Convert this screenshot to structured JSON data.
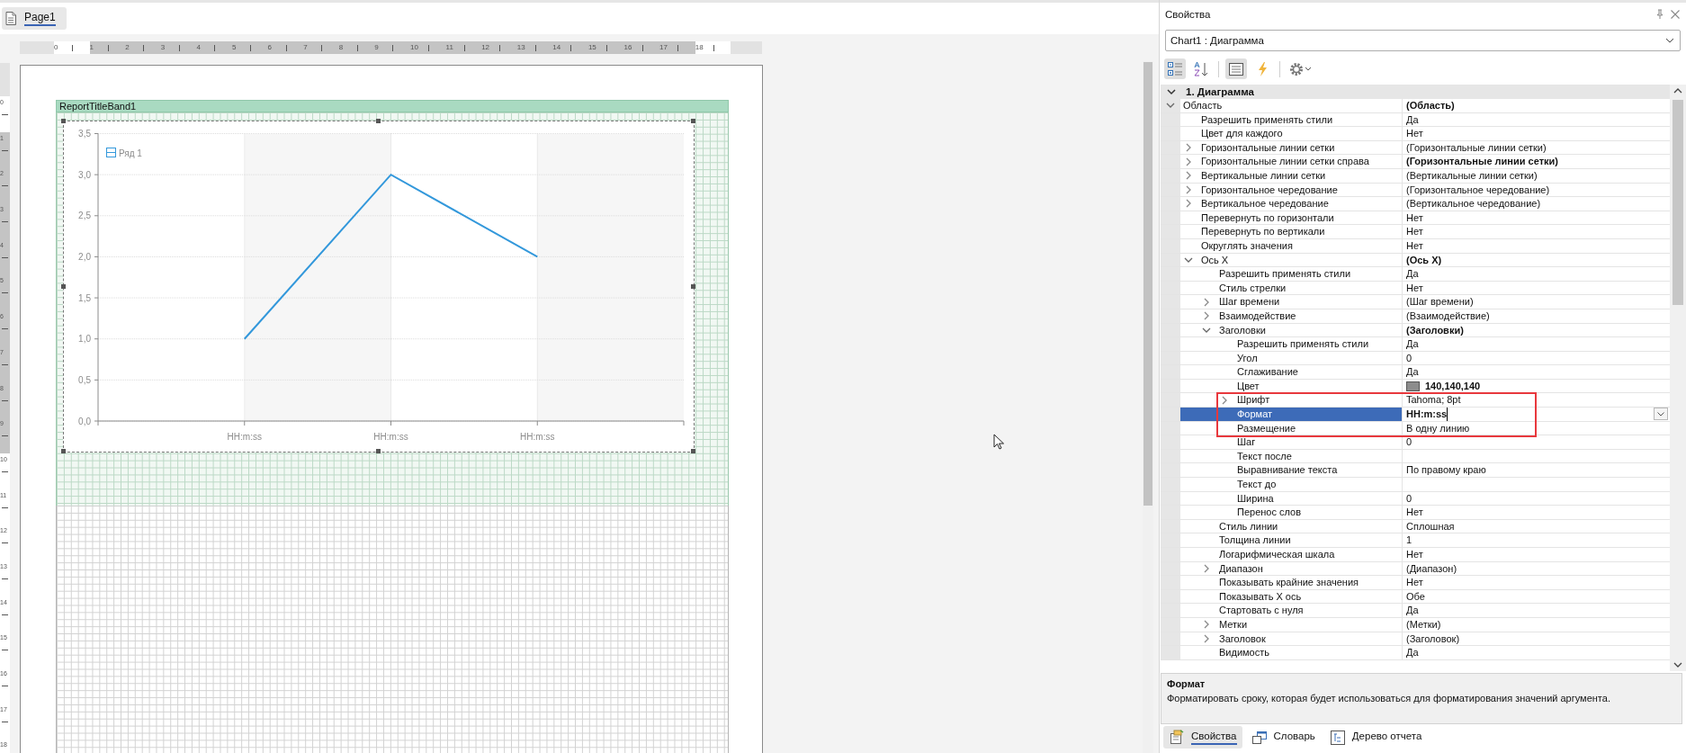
{
  "document_tabs": [
    {
      "label": "Page1",
      "selected": true
    }
  ],
  "rulers": {
    "horizontal": [
      {
        "label": "0",
        "shaded": false
      },
      {
        "label": "1",
        "shaded": true
      },
      {
        "label": "2",
        "shaded": true
      },
      {
        "label": "3",
        "shaded": true
      },
      {
        "label": "4",
        "shaded": true
      },
      {
        "label": "5",
        "shaded": true
      },
      {
        "label": "6",
        "shaded": true
      },
      {
        "label": "7",
        "shaded": true
      },
      {
        "label": "8",
        "shaded": true
      },
      {
        "label": "9",
        "shaded": true
      },
      {
        "label": "10",
        "shaded": true
      },
      {
        "label": "11",
        "shaded": true
      },
      {
        "label": "12",
        "shaded": true
      },
      {
        "label": "13",
        "shaded": true
      },
      {
        "label": "14",
        "shaded": true
      },
      {
        "label": "15",
        "shaded": true
      },
      {
        "label": "16",
        "shaded": true
      },
      {
        "label": "17",
        "shaded": true
      },
      {
        "label": "18",
        "shaded": false
      }
    ],
    "vertical": [
      {
        "label": "0",
        "shaded": false
      },
      {
        "label": "1",
        "shaded": true
      },
      {
        "label": "2",
        "shaded": true
      },
      {
        "label": "3",
        "shaded": true
      },
      {
        "label": "4",
        "shaded": true
      },
      {
        "label": "5",
        "shaded": true
      },
      {
        "label": "6",
        "shaded": true
      },
      {
        "label": "7",
        "shaded": true
      },
      {
        "label": "8",
        "shaded": true
      },
      {
        "label": "9",
        "shaded": true
      },
      {
        "label": "10",
        "shaded": false
      },
      {
        "label": "11",
        "shaded": false
      },
      {
        "label": "12",
        "shaded": false
      },
      {
        "label": "13",
        "shaded": false
      },
      {
        "label": "14",
        "shaded": false
      },
      {
        "label": "15",
        "shaded": false
      },
      {
        "label": "16",
        "shaded": false
      },
      {
        "label": "17",
        "shaded": false
      },
      {
        "label": "18",
        "shaded": false
      }
    ]
  },
  "designer": {
    "band": {
      "title": "ReportTitleBand1"
    },
    "chart": {
      "chart_data": {
        "type": "line",
        "grid": true,
        "categories": [
          "HH:m:ss",
          "HH:m:ss",
          "HH:m:ss"
        ],
        "series": [
          {
            "name": "Ряд 1",
            "color": "#3398db",
            "values": [
              1,
              3,
              2
            ]
          }
        ],
        "ylim": [
          0,
          3.5
        ],
        "yticks": [
          {
            "value": 0,
            "label": "0,0"
          },
          {
            "value": 0.5,
            "label": "0,5"
          },
          {
            "value": 1,
            "label": "1,0"
          },
          {
            "value": 1.5,
            "label": "1,5"
          },
          {
            "value": 2,
            "label": "2,0"
          },
          {
            "value": 2.5,
            "label": "2,5"
          },
          {
            "value": 3,
            "label": "3,0"
          },
          {
            "value": 3.5,
            "label": "3,5"
          }
        ]
      }
    }
  },
  "properties_panel": {
    "title": "Свойства",
    "object_selector": {
      "value": "Chart1 : Диаграмма"
    },
    "toolbar": [
      {
        "kind": "categorized",
        "selected": true
      },
      {
        "kind": "alphabetical",
        "selected": false
      },
      {
        "kind": "properties",
        "selected": true
      },
      {
        "kind": "events",
        "selected": false
      },
      {
        "kind": "settings",
        "selected": false
      }
    ],
    "category": {
      "label": "1. Диаграмма",
      "expanded": true,
      "properties": [
        {
          "name": "Область",
          "value": "(Область)",
          "modified": true,
          "expanded": true,
          "selected": false,
          "children": [
            {
              "name": "Разрешить применять стили",
              "value": "Да",
              "selected": false
            },
            {
              "name": "Цвет для каждого",
              "value": "Нет",
              "selected": false
            },
            {
              "name": "Горизонтальные линии сетки",
              "value": "(Горизонтальные линии сетки)",
              "expanded": false,
              "selected": false
            },
            {
              "name": "Горизонтальные линии сетки справа",
              "value": "(Горизонтальные линии сетки)",
              "modified": true,
              "expanded": false,
              "selected": false
            },
            {
              "name": "Вертикальные линии сетки",
              "value": "(Вертикальные линии сетки)",
              "expanded": false,
              "selected": false
            },
            {
              "name": "Горизонтальное чередование",
              "value": "(Горизонтальное чередование)",
              "expanded": false,
              "selected": false
            },
            {
              "name": "Вертикальное чередование",
              "value": "(Вертикальное чередование)",
              "expanded": false,
              "selected": false
            },
            {
              "name": "Перевернуть по горизонтали",
              "value": "Нет",
              "selected": false
            },
            {
              "name": "Перевернуть по вертикали",
              "value": "Нет",
              "selected": false
            },
            {
              "name": "Округлять значения",
              "value": "Нет",
              "selected": false
            },
            {
              "name": "Ось X",
              "value": "(Ось X)",
              "modified": true,
              "expanded": true,
              "selected": false,
              "children": [
                {
                  "name": "Разрешить применять стили",
                  "value": "Да",
                  "selected": false
                },
                {
                  "name": "Стиль стрелки",
                  "value": "Нет",
                  "selected": false
                },
                {
                  "name": "Шаг времени",
                  "value": "(Шаг времени)",
                  "expanded": false,
                  "selected": false
                },
                {
                  "name": "Взаимодействие",
                  "value": "(Взаимодействие)",
                  "expanded": false,
                  "selected": false
                },
                {
                  "name": "Заголовки",
                  "value": "(Заголовки)",
                  "modified": true,
                  "expanded": true,
                  "selected": false,
                  "children": [
                    {
                      "name": "Разрешить применять стили",
                      "value": "Да",
                      "selected": false
                    },
                    {
                      "name": "Угол",
                      "value": "0",
                      "selected": false
                    },
                    {
                      "name": "Сглаживание",
                      "value": "Да",
                      "selected": false
                    },
                    {
                      "name": "Цвет",
                      "value": "140,140,140",
                      "modified": true,
                      "color": "#8c8c8c",
                      "selected": false
                    },
                    {
                      "name": "Шрифт",
                      "value": "Tahoma; 8pt",
                      "expanded": false,
                      "highlighted": true,
                      "selected": false
                    },
                    {
                      "name": "Формат",
                      "value": "HH:m:ss",
                      "modified": true,
                      "highlighted": true,
                      "selected": true
                    },
                    {
                      "name": "Размещение",
                      "value": "В одну линию",
                      "highlighted": true,
                      "selected": false
                    },
                    {
                      "name": "Шаг",
                      "value": "0",
                      "selected": false
                    },
                    {
                      "name": "Текст после",
                      "selected": false
                    },
                    {
                      "name": "Выравнивание текста",
                      "value": "По правому краю",
                      "selected": false
                    },
                    {
                      "name": "Текст до",
                      "selected": false
                    },
                    {
                      "name": "Ширина",
                      "value": "0",
                      "selected": false
                    },
                    {
                      "name": "Перенос слов",
                      "value": "Нет",
                      "selected": false
                    }
                  ]
                },
                {
                  "name": "Стиль линии",
                  "value": "Сплошная",
                  "selected": false
                },
                {
                  "name": "Толщина линии",
                  "value": "1",
                  "selected": false
                },
                {
                  "name": "Логарифмическая шкала",
                  "value": "Нет",
                  "selected": false
                },
                {
                  "name": "Диапазон",
                  "value": "(Диапазон)",
                  "expanded": false,
                  "selected": false
                },
                {
                  "name": "Показывать крайние значения",
                  "value": "Нет",
                  "selected": false
                },
                {
                  "name": "Показывать X ось",
                  "value": "Обе",
                  "selected": false
                },
                {
                  "name": "Стартовать с нуля",
                  "value": "Да",
                  "selected": false
                },
                {
                  "name": "Метки",
                  "value": "(Метки)",
                  "expanded": false,
                  "selected": false
                },
                {
                  "name": "Заголовок",
                  "value": "(Заголовок)",
                  "expanded": false,
                  "selected": false
                },
                {
                  "name": "Видимость",
                  "value": "Да",
                  "selected": false
                }
              ]
            }
          ]
        }
      ]
    },
    "description": {
      "title": "Формат",
      "text": "Форматировать сроку, которая будет использоваться для форматирования значений аргумента."
    }
  },
  "bottom_tabs": [
    {
      "kind": "properties",
      "label": "Свойства",
      "selected": true
    },
    {
      "kind": "dictionary",
      "label": "Словарь",
      "selected": false
    },
    {
      "kind": "report_tree",
      "label": "Дерево отчета",
      "selected": false
    }
  ]
}
